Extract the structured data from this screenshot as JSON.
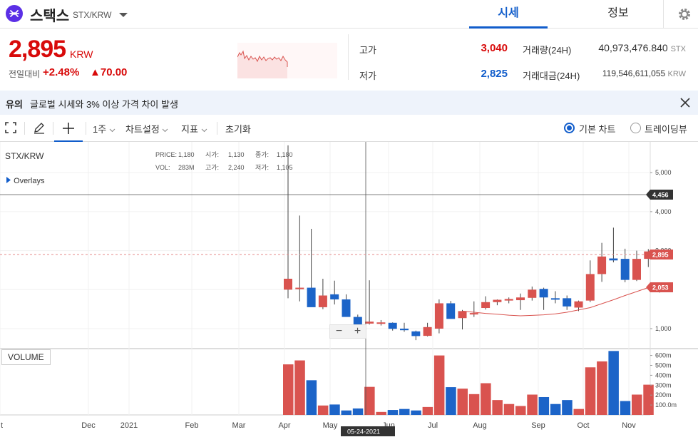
{
  "header": {
    "coin_name": "스택스",
    "coin_pair": "STX/KRW",
    "tabs": [
      "시세",
      "정보"
    ]
  },
  "summary": {
    "price": "2,895",
    "price_unit": "KRW",
    "prev_label": "전일대비",
    "change_rate": "+2.48%",
    "change_amount": "▲70.00",
    "high_label": "고가",
    "high_value": "3,040",
    "low_label": "저가",
    "low_value": "2,825",
    "volume_label": "거래량(24H)",
    "volume_value": "40,973,476.840",
    "volume_unit": "STX",
    "amount_label": "거래대금(24H)",
    "amount_value": "119,546,611,055",
    "amount_unit": "KRW"
  },
  "notice": {
    "tag": "유의",
    "text": "글로벌 시세와 3% 이상 가격 차이 발생"
  },
  "toolbar": {
    "interval": "1주",
    "chart_settings": "차트설정",
    "indicators": "지표",
    "reset": "초기화",
    "basic_chart": "기본 차트",
    "tradingview": "트레이딩뷰"
  },
  "chart_panel": {
    "symbol": "STX/KRW",
    "overlays": "Overlays",
    "volume_label": "VOLUME",
    "legend": {
      "price_label": "PRICE:",
      "price": "1,180",
      "open_label": "시가:",
      "open": "1,130",
      "close_label": "종가:",
      "close": "1,180",
      "vol_label": "VOL:",
      "vol": "283M",
      "high_label": "고가:",
      "high": "2,240",
      "low_label": "저가:",
      "low": "1,105"
    },
    "crosshair_price": "4,456",
    "crosshair_date": "05-24-2021",
    "last_price_tag": "2,895",
    "ma_tag": "2,053",
    "zoom_minus": "−",
    "zoom_plus": "+"
  },
  "colors": {
    "up": "#d9534f",
    "down": "#1c64c8",
    "accent": "#115dcb",
    "price_red": "#d80a0a"
  },
  "chart_data": {
    "type": "candlestick",
    "price_axis": {
      "ticks": [
        "1,000",
        "2,000",
        "3,000",
        "4,000",
        "5,000"
      ],
      "tick_values": [
        1000,
        2000,
        3000,
        4000,
        5000
      ]
    },
    "volume_axis": {
      "ticks": [
        "100.0m",
        "200m",
        "300m",
        "400m",
        "500m",
        "600m"
      ],
      "tick_values": [
        100,
        200,
        300,
        400,
        500,
        600
      ]
    },
    "x_ticks": [
      "t",
      "Dec",
      "2021",
      "Feb",
      "Mar",
      "Apr",
      "May",
      "Jun",
      "Jul",
      "Aug",
      "Sep",
      "Oct",
      "Nov"
    ],
    "candles": [
      {
        "o": 2000,
        "h": 5700,
        "l": 1780,
        "c": 2280,
        "v": 510
      },
      {
        "o": 2020,
        "h": 3900,
        "l": 1700,
        "c": 2050,
        "v": 550
      },
      {
        "o": 2050,
        "h": 3560,
        "l": 1820,
        "c": 1550,
        "v": 350
      },
      {
        "o": 1550,
        "h": 2280,
        "l": 1500,
        "c": 1850,
        "v": 95
      },
      {
        "o": 1880,
        "h": 2230,
        "l": 1620,
        "c": 1750,
        "v": 105
      },
      {
        "o": 1750,
        "h": 1880,
        "l": 1390,
        "c": 1300,
        "v": 45
      },
      {
        "o": 1300,
        "h": 1360,
        "l": 905,
        "c": 930,
        "v": 65
      },
      {
        "o": 1130,
        "h": 2240,
        "l": 1105,
        "c": 1180,
        "v": 283
      },
      {
        "o": 1130,
        "h": 1220,
        "l": 1080,
        "c": 1160,
        "v": 30
      },
      {
        "o": 1150,
        "h": 1160,
        "l": 950,
        "c": 995,
        "v": 50
      },
      {
        "o": 1000,
        "h": 1150,
        "l": 920,
        "c": 960,
        "v": 60
      },
      {
        "o": 930,
        "h": 950,
        "l": 705,
        "c": 810,
        "v": 45
      },
      {
        "o": 815,
        "h": 1150,
        "l": 800,
        "c": 1040,
        "v": 80
      },
      {
        "o": 1000,
        "h": 1750,
        "l": 880,
        "c": 1650,
        "v": 600
      },
      {
        "o": 1650,
        "h": 1710,
        "l": 1350,
        "c": 1250,
        "v": 280
      },
      {
        "o": 1270,
        "h": 1480,
        "l": 980,
        "c": 1450,
        "v": 265
      },
      {
        "o": 1370,
        "h": 1700,
        "l": 1300,
        "c": 1400,
        "v": 210
      },
      {
        "o": 1530,
        "h": 1830,
        "l": 1490,
        "c": 1680,
        "v": 320
      },
      {
        "o": 1680,
        "h": 1750,
        "l": 1600,
        "c": 1740,
        "v": 150
      },
      {
        "o": 1720,
        "h": 1800,
        "l": 1650,
        "c": 1760,
        "v": 110
      },
      {
        "o": 1730,
        "h": 1900,
        "l": 1480,
        "c": 1800,
        "v": 90
      },
      {
        "o": 1790,
        "h": 2080,
        "l": 1720,
        "c": 2000,
        "v": 205
      },
      {
        "o": 2020,
        "h": 2050,
        "l": 1480,
        "c": 1800,
        "v": 180
      },
      {
        "o": 1780,
        "h": 1960,
        "l": 1650,
        "c": 1770,
        "v": 110
      },
      {
        "o": 1780,
        "h": 1850,
        "l": 1480,
        "c": 1570,
        "v": 150
      },
      {
        "o": 1540,
        "h": 1720,
        "l": 1450,
        "c": 1700,
        "v": 60
      },
      {
        "o": 1720,
        "h": 2750,
        "l": 1680,
        "c": 2400,
        "v": 480
      },
      {
        "o": 2400,
        "h": 3200,
        "l": 2200,
        "c": 2850,
        "v": 540
      },
      {
        "o": 2800,
        "h": 3590,
        "l": 2700,
        "c": 2750,
        "v": 645
      },
      {
        "o": 2790,
        "h": 3050,
        "l": 2190,
        "c": 2250,
        "v": 140
      },
      {
        "o": 2250,
        "h": 3000,
        "l": 2220,
        "c": 2790,
        "v": 205
      },
      {
        "o": 2790,
        "h": 3040,
        "l": 2580,
        "c": 2980,
        "v": 305
      }
    ],
    "ma": [
      null,
      null,
      null,
      null,
      null,
      null,
      null,
      null,
      null,
      null,
      null,
      null,
      null,
      null,
      null,
      1450,
      1420,
      1390,
      1370,
      1345,
      1330,
      1340,
      1355,
      1380,
      1420,
      1480,
      1540,
      1640,
      1740,
      1850,
      1950,
      2053
    ]
  }
}
